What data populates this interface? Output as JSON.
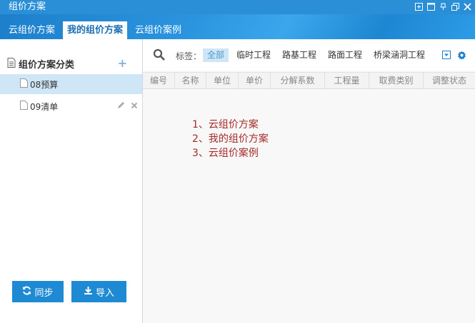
{
  "window": {
    "title": "组价方案"
  },
  "tabs": [
    {
      "label": "云组价方案"
    },
    {
      "label": "我的组价方案"
    },
    {
      "label": "云组价案例"
    }
  ],
  "sidebar": {
    "heading": "组价方案分类",
    "items": [
      {
        "label": "08预算"
      },
      {
        "label": "09清单"
      }
    ],
    "buttons": {
      "sync": "同步",
      "import": "导入"
    }
  },
  "toolbar": {
    "tag_label": "标签：",
    "tags": [
      "全部",
      "临时工程",
      "路基工程",
      "路面工程",
      "桥梁涵洞工程"
    ]
  },
  "table": {
    "columns": [
      "编号",
      "名称",
      "单位",
      "单价",
      "分解系数",
      "工程量",
      "取费类别",
      "调整状态"
    ]
  },
  "notes": [
    "1、云组价方案",
    "2、我的组价方案",
    "3、云组价案例"
  ],
  "colors": {
    "accent": "#2a8fd6",
    "selected": "#cfe6f7",
    "note": "#a52a2a"
  }
}
